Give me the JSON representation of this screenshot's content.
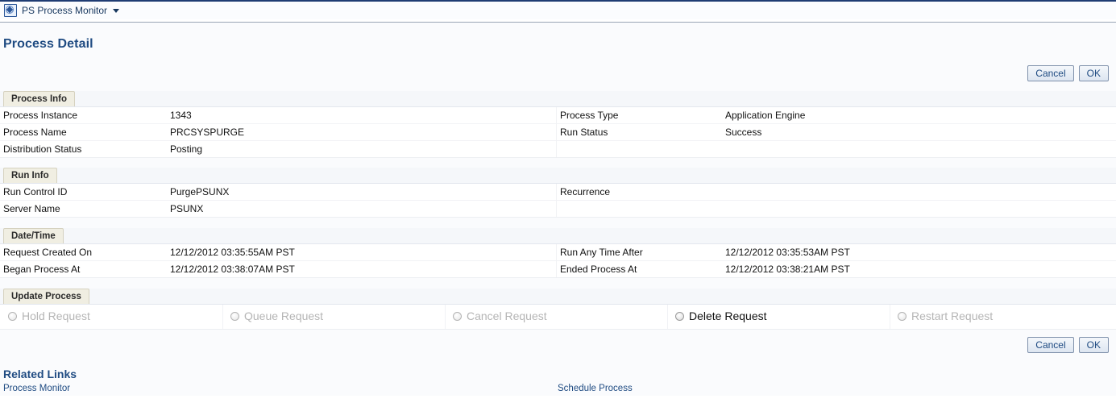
{
  "tab": {
    "label": "PS Process Monitor",
    "icon": "process-monitor-icon",
    "caret": "chevron-down-icon"
  },
  "page": {
    "title": "Process Detail"
  },
  "buttons": {
    "cancel_label": "Cancel",
    "ok_label": "OK"
  },
  "sections": {
    "process_info": {
      "title": "Process Info",
      "rows": [
        {
          "label": "Process Instance",
          "value": "1343",
          "label_right": "Process Type",
          "value_right": "Application Engine"
        },
        {
          "label": "Process Name",
          "value": "PRCSYSPURGE",
          "label_right": "Run Status",
          "value_right": "Success"
        },
        {
          "label": "Distribution Status",
          "value": "Posting",
          "label_right": "",
          "value_right": ""
        }
      ]
    },
    "run_info": {
      "title": "Run Info",
      "rows": [
        {
          "label": "Run Control ID",
          "value": "PurgePSUNX",
          "label_right": "Recurrence",
          "value_right": ""
        },
        {
          "label": "Server Name",
          "value": "PSUNX",
          "label_right": "",
          "value_right": ""
        }
      ]
    },
    "date_time": {
      "title": "Date/Time",
      "rows": [
        {
          "label": "Request Created On",
          "value": "12/12/2012 03:35:55AM PST",
          "label_right": "Run Any Time After",
          "value_right": "12/12/2012 03:35:53AM PST"
        },
        {
          "label": "Began Process At",
          "value": "12/12/2012 03:38:07AM PST",
          "label_right": "Ended Process At",
          "value_right": "12/12/2012 03:38:21AM PST"
        }
      ]
    },
    "update_process": {
      "title": "Update Process",
      "options": [
        {
          "label": "Hold Request",
          "enabled": false,
          "selected": false
        },
        {
          "label": "Queue Request",
          "enabled": false,
          "selected": false
        },
        {
          "label": "Cancel Request",
          "enabled": false,
          "selected": false
        },
        {
          "label": "Delete Request",
          "enabled": true,
          "selected": false
        },
        {
          "label": "Restart Request",
          "enabled": false,
          "selected": false
        }
      ]
    }
  },
  "related_links": {
    "title": "Related Links",
    "links": [
      {
        "label": "Process Monitor"
      },
      {
        "label": "Schedule Process"
      }
    ]
  },
  "colors": {
    "accent": "#1f4b82",
    "section_tab_bg": "#f0eee2",
    "page_bg": "#fafbfd"
  }
}
